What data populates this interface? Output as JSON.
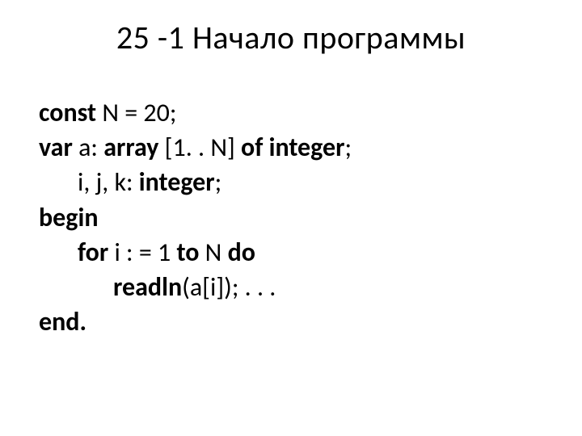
{
  "slide": {
    "title": "25 -1 Начало программы",
    "code": {
      "l1": {
        "kw_const": "const",
        "rest": " N = 20;"
      },
      "l2": {
        "kw_var": "var",
        "mid": " a: ",
        "kw_array": "array",
        "range": " [1. . N] ",
        "kw_of": "of integer",
        "tail": ";"
      },
      "l3": {
        "vars": "i, j, k: ",
        "kw_integer": "integer",
        "tail": ";"
      },
      "l4": {
        "kw_begin": "begin"
      },
      "l5": {
        "kw_for": "for",
        "mid1": " i : = 1 ",
        "kw_to": "to",
        "mid2": " N ",
        "kw_do": "do"
      },
      "l6": {
        "kw_readln": "readln",
        "args": "(a[i]); . . ."
      },
      "l7": {
        "kw_end": "end."
      }
    }
  }
}
